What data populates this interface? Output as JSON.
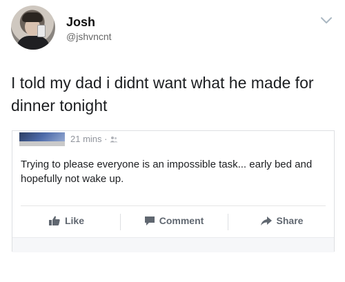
{
  "tweet": {
    "author_name": "Josh",
    "author_handle": "@jshvncnt",
    "text": "I told my dad i didnt want what he made for dinner tonight"
  },
  "embedded_post": {
    "timestamp": "21 mins",
    "privacy_separator": "·",
    "privacy_icon": "friends-icon",
    "body": "Trying to please everyone is an impossible task... early bed and hopefully not wake up.",
    "actions": {
      "like": "Like",
      "comment": "Comment",
      "share": "Share"
    }
  },
  "colors": {
    "text": "#1c1e21",
    "muted": "#90949c",
    "action_text": "#606770",
    "border": "#dddfe2"
  }
}
